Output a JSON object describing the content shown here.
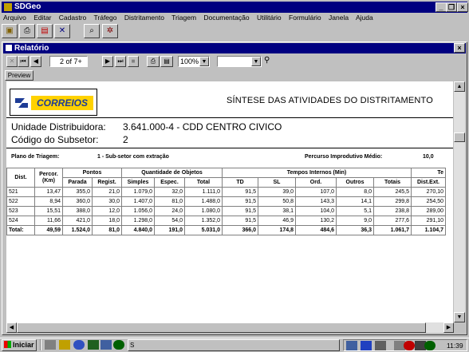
{
  "app": {
    "title": "SDGeo"
  },
  "menu": [
    "Arquivo",
    "Editar",
    "Cadastro",
    "Tráfego",
    "Distritamento",
    "Triagem",
    "Documentação",
    "Utilitário",
    "Formulário",
    "Janela",
    "Ajuda"
  ],
  "report_window": {
    "title": "Relatório"
  },
  "report_toolbar": {
    "page_current": "2",
    "page_total": "of 7+",
    "zoom": "100%",
    "search": ""
  },
  "tabs": {
    "preview": "Preview"
  },
  "report": {
    "logo_text": "CORREIOS",
    "heading": "SÍNTESE DAS ATIVIDADES DO DISTRITAMENTO",
    "unidade_label": "Unidade Distribuidora:",
    "unidade_value": "3.641.000-4 - CDD CENTRO CIVICO",
    "subsetor_label": "Código do Subsetor:",
    "subsetor_value": "2",
    "plano_label": "Plano de Triagem:",
    "plano_value": "1 - Sub-setor com extração",
    "percurso_label": "Percurso Improdutivo Médio:",
    "percurso_value": "10,0",
    "group_headers": {
      "pontos": "Pontos",
      "quantidade": "Quantidade de Objetos",
      "tempos": "Tempos Internos  (Min)",
      "te": "Te"
    },
    "columns": {
      "dist": "Dist.",
      "percor": "Percor.",
      "km": "(Km)",
      "parada": "Parada",
      "regist": "Regist.",
      "simples": "Simples",
      "espec": "Espec.",
      "total": "Total",
      "td": "TD",
      "sl": "SL",
      "ord": "Ord.",
      "outros": "Outros",
      "totais": "Totais",
      "distext": "Dist.Ext."
    },
    "rows": [
      [
        "521",
        "13,47",
        "355,0",
        "21,0",
        "1.079,0",
        "32,0",
        "1.111,0",
        "91,5",
        "39,0",
        "107,0",
        "8,0",
        "245,5",
        "270,10"
      ],
      [
        "522",
        "8,94",
        "360,0",
        "30,0",
        "1.407,0",
        "81,0",
        "1.488,0",
        "91,5",
        "50,8",
        "143,3",
        "14,1",
        "299,8",
        "254,50"
      ],
      [
        "523",
        "15,51",
        "388,0",
        "12,0",
        "1.056,0",
        "24,0",
        "1.080,0",
        "91,5",
        "38,1",
        "104,0",
        "5,1",
        "238,8",
        "289,00"
      ],
      [
        "524",
        "11,66",
        "421,0",
        "18,0",
        "1.298,0",
        "54,0",
        "1.352,0",
        "91,5",
        "46,9",
        "130,2",
        "9,0",
        "277,6",
        "291,10"
      ]
    ],
    "total_row": [
      "Total:",
      "49,59",
      "1.524,0",
      "81,0",
      "4.840,0",
      "191,0",
      "5.031,0",
      "366,0",
      "174,8",
      "484,6",
      "36,3",
      "1.061,7",
      "1.104,7"
    ]
  },
  "taskbar": {
    "start_label": "Iniciar",
    "clock": "11:39",
    "task_label": "S"
  }
}
